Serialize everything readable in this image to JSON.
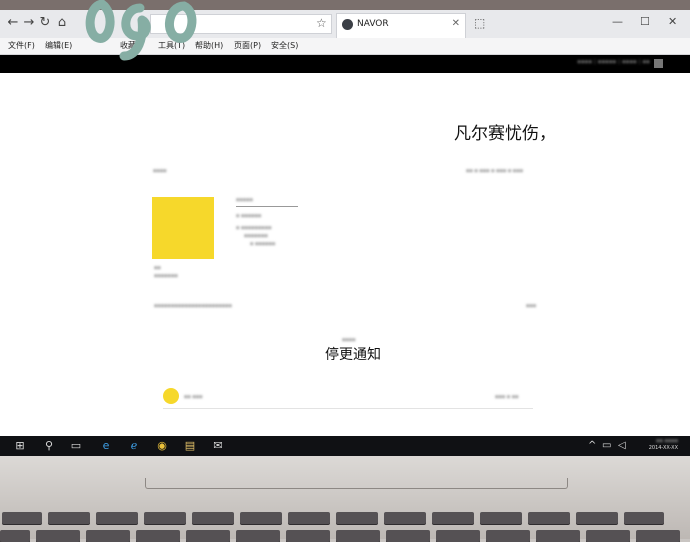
{
  "browser": {
    "tab_title": "NAVOR",
    "menu_items": [
      "文件(F)",
      "编辑(E)",
      "收藏(",
      "工具(T)",
      "帮助(H)",
      "页面(P)",
      "安全(S)"
    ]
  },
  "page": {
    "overlay_title": "凡尔赛忧伤，",
    "notice": "停更通知"
  },
  "taskbar": {
    "date": "2014-XX-XX"
  },
  "icons": {
    "back": "back-arrow-icon",
    "forward": "forward-arrow-icon",
    "refresh": "refresh-icon",
    "home": "home-icon",
    "favorite": "star-icon",
    "tab_favicon": "globe-icon",
    "start": "windows-start-icon",
    "search": "search-icon",
    "edge": "edge-icon",
    "ie": "internet-explorer-icon",
    "chrome": "chrome-icon",
    "explorer": "folder-icon",
    "mail": "mail-icon"
  },
  "colors": {
    "accent_yellow": "#f6d82b",
    "page_header": "#000000",
    "taskbar": "#101114"
  }
}
